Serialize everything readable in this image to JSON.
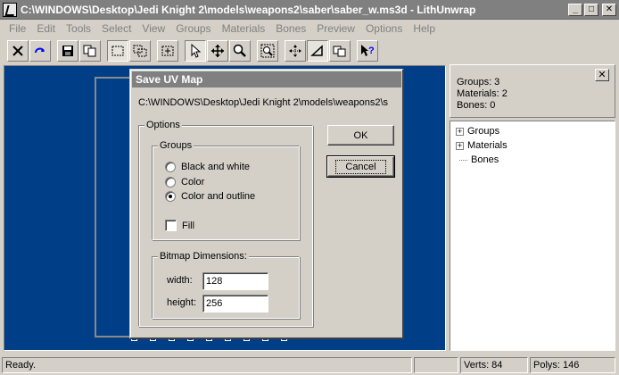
{
  "window": {
    "title": "C:\\WINDOWS\\Desktop\\Jedi Knight 2\\models\\weapons2\\saber\\saber_w.ms3d - LithUnwrap",
    "minimize": "_",
    "maximize": "□",
    "close": "✕"
  },
  "menu": [
    "File",
    "Edit",
    "Tools",
    "Select",
    "View",
    "Groups",
    "Materials",
    "Bones",
    "Preview",
    "Options",
    "Help"
  ],
  "info_panel": {
    "groups": "Groups: 3",
    "materials": "Materials: 2",
    "bones": "Bones: 0",
    "close": "✕"
  },
  "tree": {
    "items": [
      {
        "label": "Groups",
        "expander": "+"
      },
      {
        "label": "Materials",
        "expander": "+"
      },
      {
        "label": "Bones"
      }
    ]
  },
  "status": {
    "text": "Ready.",
    "verts": "Verts: 84",
    "polys": "Polys: 146"
  },
  "dialog": {
    "title": "Save UV Map",
    "path": "C:\\WINDOWS\\Desktop\\Jedi Knight 2\\models\\weapons2\\s",
    "options_label": "Options",
    "groups_label": "Groups",
    "radios": [
      {
        "label": "Black and white",
        "checked": false
      },
      {
        "label": "Color",
        "checked": false
      },
      {
        "label": "Color and outline",
        "checked": true
      }
    ],
    "fill_label": "Fill",
    "bitmap_label": "Bitmap Dimensions:",
    "width_label": "width:",
    "width_value": "128",
    "height_label": "height:",
    "height_value": "256",
    "ok_label": "OK",
    "cancel_label": "Cancel"
  },
  "colors": {
    "viewport_bg": "#003f87",
    "inactive_title": "#808080"
  }
}
